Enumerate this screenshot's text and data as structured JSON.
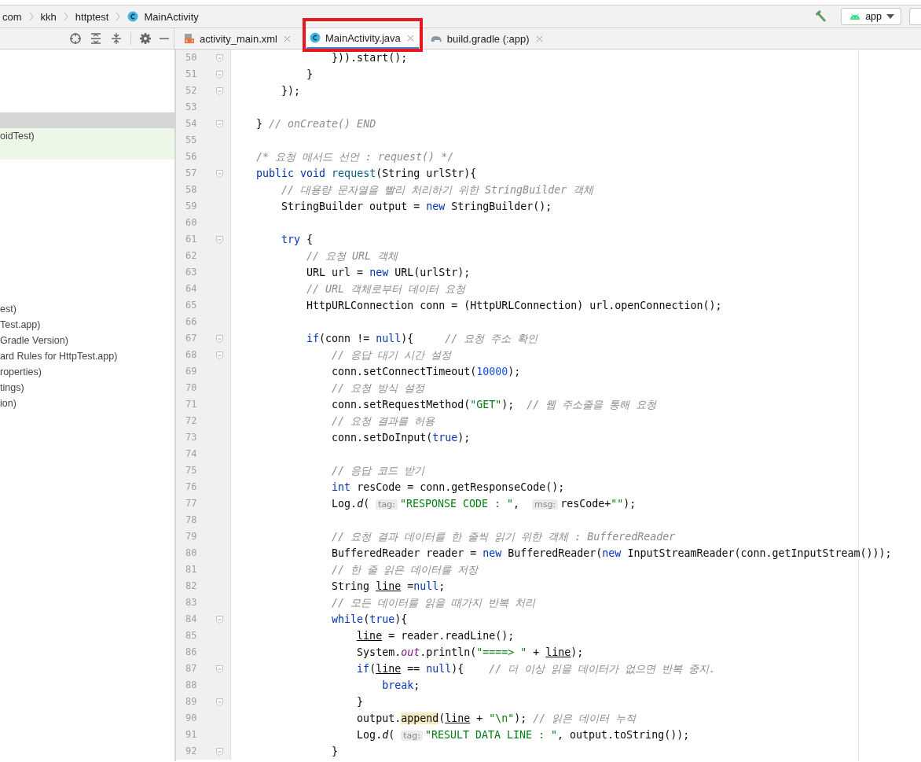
{
  "breadcrumb": [
    {
      "label": "com",
      "kind": "folder"
    },
    {
      "label": "kkh",
      "kind": "folder"
    },
    {
      "label": "httptest",
      "kind": "folder"
    },
    {
      "label": "MainActivity",
      "kind": "class"
    }
  ],
  "run_config": {
    "label": "app"
  },
  "project_panel": {
    "rows": [
      {
        "selected": true,
        "highlighted": false
      },
      {
        "label": "oidTest)",
        "selected": false,
        "highlighted": true
      },
      {
        "selected": false,
        "highlighted": true
      },
      {
        "label": "est)",
        "selected": false,
        "highlighted": false
      },
      {
        "label": "Test.app)",
        "selected": false,
        "highlighted": false
      },
      {
        "label": "Gradle Version)",
        "selected": false,
        "highlighted": false
      },
      {
        "label": "ard Rules for HttpTest.app)",
        "selected": false,
        "highlighted": false
      },
      {
        "label": "roperties)",
        "selected": false,
        "highlighted": false
      },
      {
        "label": "tings)",
        "selected": false,
        "highlighted": false
      },
      {
        "label": "ion)",
        "selected": false,
        "highlighted": false
      }
    ]
  },
  "tabs": [
    {
      "label": "activity_main.xml",
      "kind": "xml",
      "selected": false,
      "annotated": false
    },
    {
      "label": "MainActivity.java",
      "kind": "class",
      "selected": true,
      "annotated": true
    },
    {
      "label": "build.gradle (:app)",
      "kind": "gradle",
      "selected": false,
      "annotated": false
    }
  ],
  "editor": {
    "lines": [
      {
        "number": "50",
        "fold": true,
        "tokens": [
          {
            "kind": "plain",
            "text": "                })).start();"
          }
        ]
      },
      {
        "number": "51",
        "fold": true,
        "tokens": [
          {
            "kind": "plain",
            "text": "            }"
          }
        ]
      },
      {
        "number": "52",
        "fold": true,
        "tokens": [
          {
            "kind": "plain",
            "text": "        });"
          }
        ]
      },
      {
        "number": "53",
        "fold": false
      },
      {
        "number": "54",
        "fold": true,
        "tokens": [
          {
            "kind": "plain",
            "text": "    } "
          },
          {
            "kind": "comment",
            "text": "// onCreate() END"
          }
        ]
      },
      {
        "number": "55",
        "fold": false
      },
      {
        "number": "56",
        "fold": false,
        "tokens": [
          {
            "kind": "comment",
            "text": "    /* 요청 메서드 선언 : request() */"
          }
        ]
      },
      {
        "number": "57",
        "fold": true,
        "tokens": [
          {
            "kind": "keyword",
            "text": "    public void "
          },
          {
            "kind": "method",
            "text": "request"
          },
          {
            "kind": "plain",
            "text": "(String urlStr){"
          }
        ]
      },
      {
        "number": "58",
        "fold": false,
        "tokens": [
          {
            "kind": "comment",
            "text": "        // 대용량 문자열을 빨리 처리하기 위한 StringBuilder 객체"
          }
        ]
      },
      {
        "number": "59",
        "fold": false,
        "tokens": [
          {
            "kind": "plain",
            "text": "        StringBuilder output = "
          },
          {
            "kind": "keyword",
            "text": "new "
          },
          {
            "kind": "plain",
            "text": "StringBuilder();"
          }
        ]
      },
      {
        "number": "60",
        "fold": false
      },
      {
        "number": "61",
        "fold": true,
        "tokens": [
          {
            "kind": "keyword",
            "text": "        try "
          },
          {
            "kind": "plain",
            "text": "{"
          }
        ]
      },
      {
        "number": "62",
        "fold": false,
        "tokens": [
          {
            "kind": "comment",
            "text": "            // 요청 URL 객체"
          }
        ]
      },
      {
        "number": "63",
        "fold": false,
        "tokens": [
          {
            "kind": "plain",
            "text": "            URL url = "
          },
          {
            "kind": "keyword",
            "text": "new "
          },
          {
            "kind": "plain",
            "text": "URL(urlStr);"
          }
        ]
      },
      {
        "number": "64",
        "fold": false,
        "tokens": [
          {
            "kind": "comment",
            "text": "            // URL 객체로부터 데이터 요청"
          }
        ]
      },
      {
        "number": "65",
        "fold": false,
        "tokens": [
          {
            "kind": "plain",
            "text": "            HttpURLConnection conn = (HttpURLConnection) url.openConnection();"
          }
        ]
      },
      {
        "number": "66",
        "fold": false
      },
      {
        "number": "67",
        "fold": true,
        "tokens": [
          {
            "kind": "keyword",
            "text": "            if"
          },
          {
            "kind": "plain",
            "text": "(conn != "
          },
          {
            "kind": "keyword",
            "text": "null"
          },
          {
            "kind": "plain",
            "text": "){     "
          },
          {
            "kind": "comment",
            "text": "// 요청 주소 확인"
          }
        ]
      },
      {
        "number": "68",
        "fold": true,
        "tokens": [
          {
            "kind": "comment",
            "text": "                // 응답 대기 시간 설정"
          }
        ]
      },
      {
        "number": "69",
        "fold": false,
        "tokens": [
          {
            "kind": "plain",
            "text": "                conn.setConnectTimeout("
          },
          {
            "kind": "number",
            "text": "10000"
          },
          {
            "kind": "plain",
            "text": ");"
          }
        ]
      },
      {
        "number": "70",
        "fold": false,
        "tokens": [
          {
            "kind": "comment",
            "text": "                // 요청 방식 설정"
          }
        ]
      },
      {
        "number": "71",
        "fold": false,
        "tokens": [
          {
            "kind": "plain",
            "text": "                conn.setRequestMethod("
          },
          {
            "kind": "string",
            "text": "\"GET\""
          },
          {
            "kind": "plain",
            "text": ");  "
          },
          {
            "kind": "comment",
            "text": "// 웹 주소줄을 통해 요청"
          }
        ]
      },
      {
        "number": "72",
        "fold": false,
        "tokens": [
          {
            "kind": "comment",
            "text": "                // 요청 결과를 허용"
          }
        ]
      },
      {
        "number": "73",
        "fold": false,
        "tokens": [
          {
            "kind": "plain",
            "text": "                conn.setDoInput("
          },
          {
            "kind": "keyword",
            "text": "true"
          },
          {
            "kind": "plain",
            "text": ");"
          }
        ]
      },
      {
        "number": "74",
        "fold": false
      },
      {
        "number": "75",
        "fold": false,
        "tokens": [
          {
            "kind": "comment",
            "text": "                // 응답 코드 받기"
          }
        ]
      },
      {
        "number": "76",
        "fold": false,
        "tokens": [
          {
            "kind": "keyword",
            "text": "                int "
          },
          {
            "kind": "plain",
            "text": "resCode = conn.getResponseCode();"
          }
        ]
      },
      {
        "number": "77",
        "fold": false,
        "tokens": [
          {
            "kind": "plain",
            "text": "                Log."
          },
          {
            "kind": "italic",
            "text": "d"
          },
          {
            "kind": "plain",
            "text": "( "
          },
          {
            "kind": "hint",
            "text": "tag:"
          },
          {
            "kind": "string",
            "text": "\"RESPONSE CODE : \""
          },
          {
            "kind": "plain",
            "text": ",  "
          },
          {
            "kind": "hint",
            "text": "msg:"
          },
          {
            "kind": "plain",
            "text": "resCode+"
          },
          {
            "kind": "string",
            "text": "\"\""
          },
          {
            "kind": "plain",
            "text": ");"
          }
        ]
      },
      {
        "number": "78",
        "fold": false
      },
      {
        "number": "79",
        "fold": false,
        "tokens": [
          {
            "kind": "comment",
            "text": "                // 요청 결과 데이터를 한 줄씩 읽기 위한 객체 : BufferedReader"
          }
        ]
      },
      {
        "number": "80",
        "fold": false,
        "tokens": [
          {
            "kind": "plain",
            "text": "                BufferedReader reader = "
          },
          {
            "kind": "keyword",
            "text": "new "
          },
          {
            "kind": "plain",
            "text": "BufferedReader("
          },
          {
            "kind": "keyword",
            "text": "new "
          },
          {
            "kind": "plain",
            "text": "InputStreamReader(conn.getInputStream()));"
          }
        ]
      },
      {
        "number": "81",
        "fold": false,
        "tokens": [
          {
            "kind": "comment",
            "text": "                // 한 줄 읽은 데이터를 저장"
          }
        ]
      },
      {
        "number": "82",
        "fold": false,
        "tokens": [
          {
            "kind": "plain",
            "text": "                String "
          },
          {
            "kind": "variable",
            "text": "line"
          },
          {
            "kind": "plain",
            "text": " ="
          },
          {
            "kind": "keyword",
            "text": "null"
          },
          {
            "kind": "plain",
            "text": ";"
          }
        ]
      },
      {
        "number": "83",
        "fold": false,
        "tokens": [
          {
            "kind": "comment",
            "text": "                // 모든 데이터를 읽을 때가지 반복 처리"
          }
        ]
      },
      {
        "number": "84",
        "fold": true,
        "tokens": [
          {
            "kind": "keyword",
            "text": "                while"
          },
          {
            "kind": "plain",
            "text": "("
          },
          {
            "kind": "keyword",
            "text": "true"
          },
          {
            "kind": "plain",
            "text": "){"
          }
        ]
      },
      {
        "number": "85",
        "fold": false,
        "tokens": [
          {
            "kind": "variable",
            "text": "                    line"
          },
          {
            "kind": "plain",
            "text": " = reader.readLine();"
          }
        ]
      },
      {
        "number": "86",
        "fold": false,
        "tokens": [
          {
            "kind": "plain",
            "text": "                    System."
          },
          {
            "kind": "static",
            "text": "out"
          },
          {
            "kind": "plain",
            "text": ".println("
          },
          {
            "kind": "string",
            "text": "\"====> \""
          },
          {
            "kind": "plain",
            "text": " + "
          },
          {
            "kind": "variable",
            "text": "line"
          },
          {
            "kind": "plain",
            "text": ");"
          }
        ]
      },
      {
        "number": "87",
        "fold": true,
        "tokens": [
          {
            "kind": "keyword",
            "text": "                    if"
          },
          {
            "kind": "plain",
            "text": "("
          },
          {
            "kind": "variable",
            "text": "line"
          },
          {
            "kind": "plain",
            "text": " == "
          },
          {
            "kind": "keyword",
            "text": "null"
          },
          {
            "kind": "plain",
            "text": "){    "
          },
          {
            "kind": "comment",
            "text": "// 더 이상 읽을 데이터가 없으면 반복 중지."
          }
        ]
      },
      {
        "number": "88",
        "fold": false,
        "tokens": [
          {
            "kind": "keyword",
            "text": "                        break"
          },
          {
            "kind": "plain",
            "text": ";"
          }
        ]
      },
      {
        "number": "89",
        "fold": true,
        "tokens": [
          {
            "kind": "plain",
            "text": "                    }"
          }
        ]
      },
      {
        "number": "90",
        "fold": false,
        "tokens": [
          {
            "kind": "plain",
            "text": "                    output."
          },
          {
            "kind": "highlight",
            "text": "append"
          },
          {
            "kind": "plain",
            "text": "("
          },
          {
            "kind": "variable",
            "text": "line"
          },
          {
            "kind": "plain",
            "text": " + "
          },
          {
            "kind": "string",
            "text": "\"\\n\""
          },
          {
            "kind": "plain",
            "text": "); "
          },
          {
            "kind": "comment",
            "text": "// 읽은 데이터 누적"
          }
        ]
      },
      {
        "number": "91",
        "fold": false,
        "tokens": [
          {
            "kind": "plain",
            "text": "                    Log."
          },
          {
            "kind": "italic",
            "text": "d"
          },
          {
            "kind": "plain",
            "text": "( "
          },
          {
            "kind": "hint",
            "text": "tag:"
          },
          {
            "kind": "string",
            "text": "\"RESULT DATA LINE : \""
          },
          {
            "kind": "plain",
            "text": ", output.toString());"
          }
        ]
      },
      {
        "number": "92",
        "fold": true,
        "tokens": [
          {
            "kind": "plain",
            "text": "                }"
          }
        ]
      }
    ]
  }
}
